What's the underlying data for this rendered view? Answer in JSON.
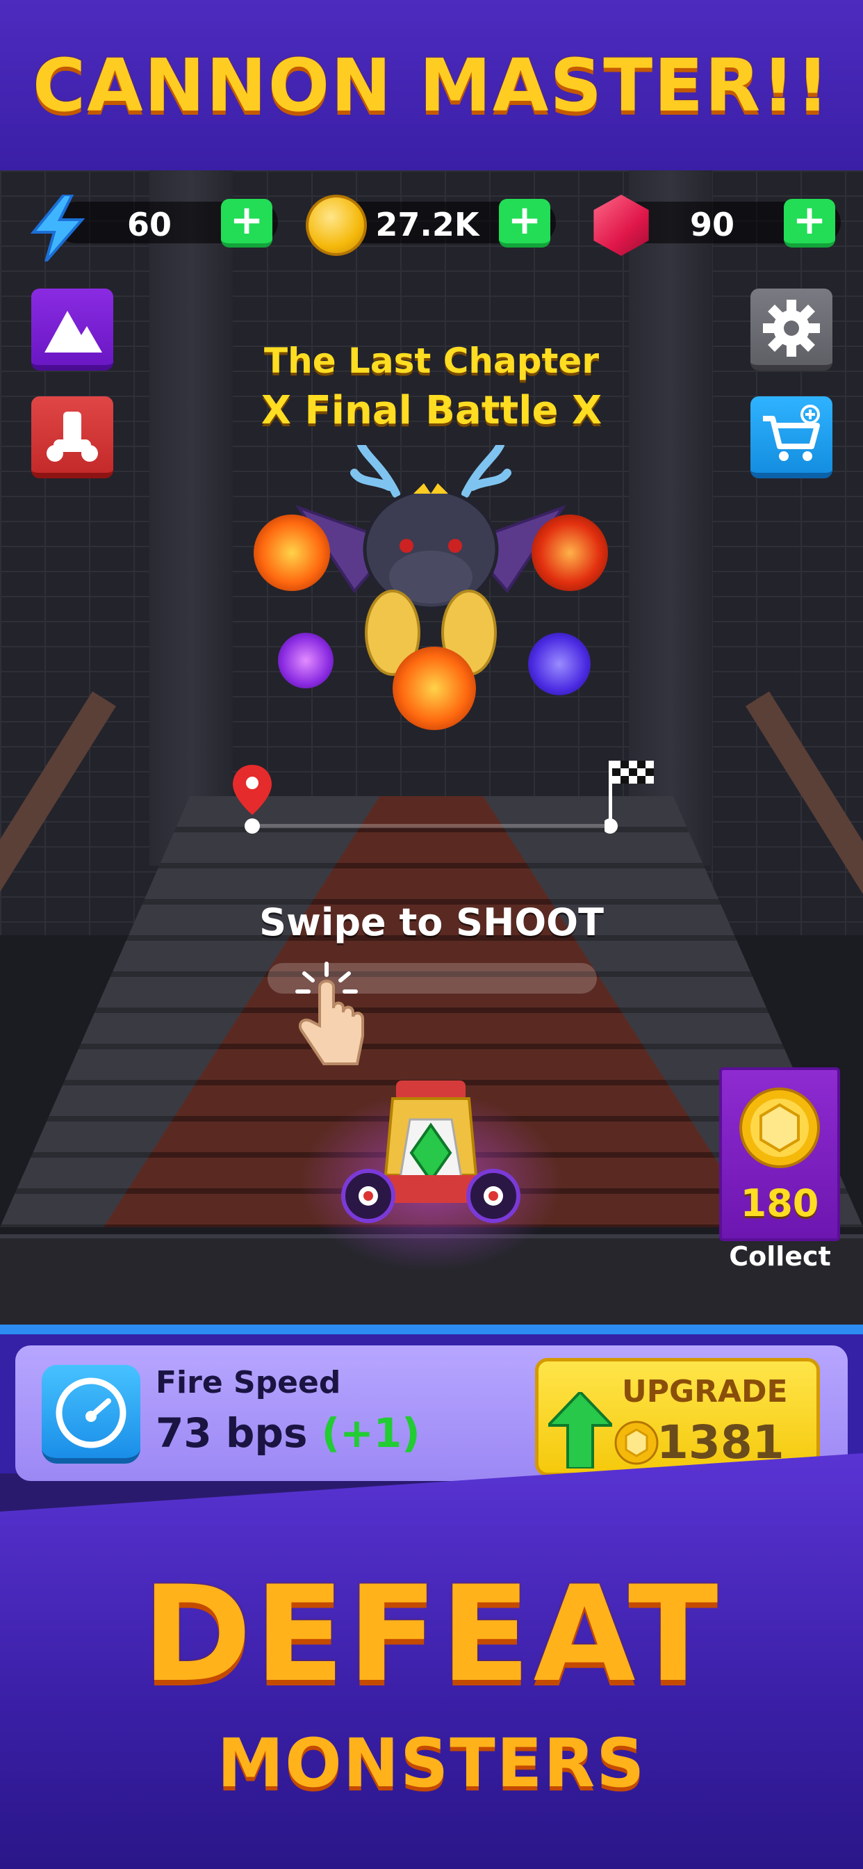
{
  "promo": {
    "top_title": "CANNON MASTER!!",
    "bottom_line1": "DEFEAT",
    "bottom_line2": "MONSTERS"
  },
  "resources": {
    "energy": {
      "icon": "lightning-bolt-icon",
      "value": "60"
    },
    "coins": {
      "icon": "coin-icon",
      "value": "27.2K"
    },
    "gems": {
      "icon": "gem-icon",
      "value": "90"
    },
    "add_symbol": "+"
  },
  "side_buttons": {
    "left": [
      "mountain-icon",
      "cannon-icon"
    ],
    "right": [
      "gear-icon",
      "cart-plus-icon"
    ]
  },
  "chapter": {
    "title": "The Last Chapter",
    "subtitle": "X Final Battle X"
  },
  "hint": {
    "label": "Swipe to SHOOT"
  },
  "collect": {
    "value": "180",
    "label": "Collect"
  },
  "upgrade": {
    "stat_name": "Fire Speed",
    "stat_value": "73 bps",
    "stat_bonus": "(+1)",
    "button_label": "UPGRADE",
    "cost": "1381"
  },
  "colors": {
    "accent_gold": "#ffcc22",
    "panel_purple": "#9c88f4",
    "plus_green": "#22dd55",
    "sky_blue": "#2c8cf2"
  }
}
